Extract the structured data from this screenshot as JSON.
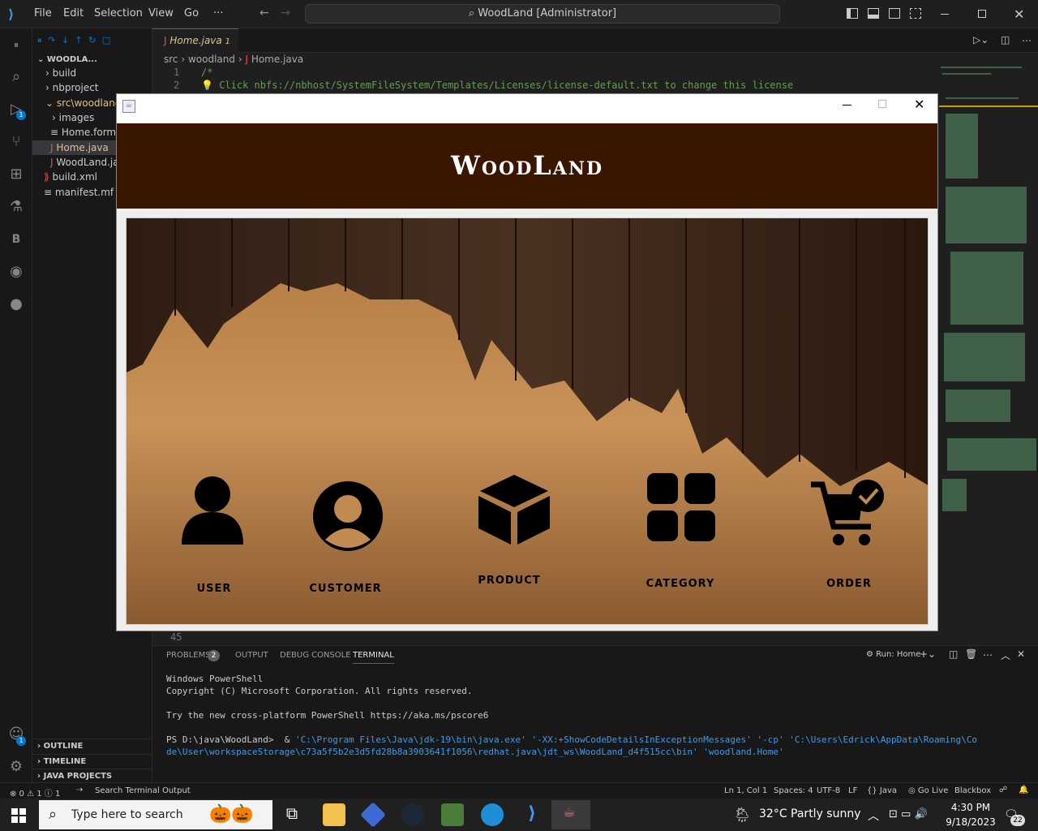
{
  "titlebar": {
    "menu": [
      "File",
      "Edit",
      "Selection",
      "View",
      "Go",
      "···"
    ],
    "command_center": "WoodLand [Administrator]"
  },
  "activity": {
    "extensions_badge": "1",
    "accounts_badge": "1"
  },
  "explorer": {
    "root": "WOODLA...",
    "items": [
      "build",
      "nbproject",
      "src\\woodland",
      "images",
      "Home.form",
      "Home.java",
      "WoodLand.ja",
      "build.xml",
      "manifest.mf"
    ],
    "sections": [
      "OUTLINE",
      "TIMELINE",
      "JAVA PROJECTS"
    ]
  },
  "editor": {
    "tab_label": "Home.java",
    "tab_badge": "1",
    "breadcrumb": [
      "src",
      "woodland",
      "Home.java"
    ],
    "line_numbers": [
      "1",
      "2",
      "45"
    ],
    "line1": "/*",
    "line2": "Click nbfs://nbhost/SystemFileSystem/Templates/Licenses/license-default.txt to change this license"
  },
  "app": {
    "title": "WoodLand",
    "menu_items": [
      {
        "label": "USER",
        "icon": "user-icon"
      },
      {
        "label": "CUSTOMER",
        "icon": "customer-icon"
      },
      {
        "label": "PRODUCT",
        "icon": "product-icon"
      },
      {
        "label": "CATEGORY",
        "icon": "category-icon"
      },
      {
        "label": "ORDER",
        "icon": "order-cart-icon"
      }
    ],
    "colors": {
      "header": "#3a1500",
      "wood_dark": "#3b2416",
      "wood_light": "#c08a50"
    }
  },
  "panel": {
    "tabs": [
      "PROBLEMS",
      "OUTPUT",
      "DEBUG CONSOLE",
      "TERMINAL"
    ],
    "problems_count": "2",
    "run_label": "Run: Home",
    "terminal": [
      "Windows PowerShell",
      "Copyright (C) Microsoft Corporation. All rights reserved.",
      "",
      "Try the new cross-platform PowerShell https://aka.ms/pscore6",
      ""
    ],
    "prompt": "PS D:\\java\\WoodLand>  & ",
    "command_1": "'C:\\Program Files\\Java\\jdk-19\\bin\\java.exe' '-XX:+ShowCodeDetailsInExceptionMessages' '-cp' 'C:\\Users\\Edrick\\AppData\\Roaming\\Co",
    "command_2": "de\\User\\workspaceStorage\\c73a5f5b2e3d5fd28b8a3903641f1056\\redhat.java\\jdt_ws\\WoodLand_d4f515cc\\bin' 'woodland.Home'"
  },
  "status": {
    "left": [
      "⊗ 0  ⚠ 1  ⓘ 1",
      "Search Terminal Output"
    ],
    "right": [
      "Ln 1, Col 1",
      "Spaces: 4",
      "UTF-8",
      "LF",
      "{} Java",
      "Go Live",
      "Blackbox"
    ]
  },
  "taskbar": {
    "search_placeholder": "Type here to search",
    "weather": "32°C  Partly sunny",
    "time": "4:30 PM",
    "date": "9/18/2023",
    "notifications": "22"
  }
}
